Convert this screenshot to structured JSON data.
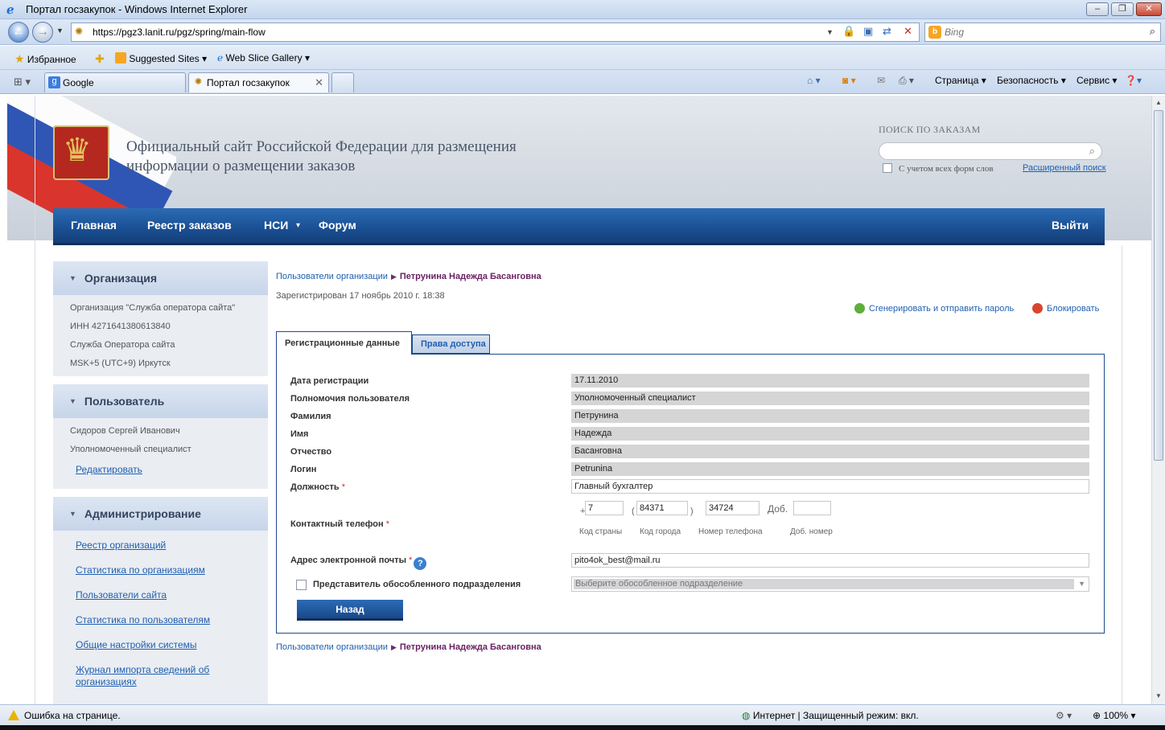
{
  "browser": {
    "window_title": "Портал госзакупок - Windows Internet Explorer",
    "url": "https://pgz3.lanit.ru/pgz/spring/main-flow",
    "search_placeholder": "Bing",
    "favorites_label": "Избранное",
    "suggested_sites": "Suggested Sites",
    "web_slice_gallery": "Web Slice Gallery",
    "tabs": [
      {
        "label": "Google"
      },
      {
        "label": "Портал госзакупок"
      }
    ],
    "commands": {
      "page": "Страница",
      "safety": "Безопасность",
      "tools": "Сервис"
    },
    "status_left": "Ошибка на странице.",
    "status_zone": "Интернет | Защищенный режим: вкл.",
    "zoom": "100%"
  },
  "header": {
    "title": "Официальный сайт Российской Федерации для размещения информации о размещении заказов",
    "search_title": "ПОИСК ПО ЗАКАЗАМ",
    "all_forms_label": "С учетом всех форм слов",
    "advanced_search": "Расширенный поиск"
  },
  "nav": {
    "items": [
      "Главная",
      "Реестр заказов",
      "НСИ",
      "Форум"
    ],
    "nsi_arrow": "▾",
    "logout": "Выйти"
  },
  "sidebar": {
    "organization": {
      "title": "Организация",
      "lines": [
        "Организация \"Служба оператора сайта\"",
        "ИНН 4271641380613840",
        "Служба Оператора сайта",
        "MSK+5 (UTC+9) Иркутск"
      ]
    },
    "user": {
      "title": "Пользователь",
      "lines": [
        "Сидоров Сергей Иванович",
        "Уполномоченный специалист"
      ],
      "edit_link": "Редактировать"
    },
    "admin": {
      "title": "Администрирование",
      "links": [
        "Реестр организаций",
        "Статистика по организациям",
        "Пользователи сайта",
        "Статистика по пользователям",
        "Общие настройки системы",
        "Журнал импорта сведений об организациях"
      ]
    }
  },
  "content": {
    "breadcrumb_parent": "Пользователи организации",
    "breadcrumb_current": "Петрунина Надежда Басанговна",
    "registered": "Зарегистрирован 17 ноябрь 2010 г. 18:38",
    "generate_password": "Сгенерировать и отправить пароль",
    "block": "Блокировать",
    "tabs": {
      "registration": "Регистрационные данные",
      "access": "Права доступа"
    },
    "fields": [
      {
        "label": "Дата регистрации",
        "value": "17.11.2010"
      },
      {
        "label": "Полномочия пользователя",
        "value": "Уполномоченный специалист"
      },
      {
        "label": "Фамилия",
        "value": "Петрунина"
      },
      {
        "label": "Имя",
        "value": "Надежда"
      },
      {
        "label": "Отчество",
        "value": "Басанговна"
      },
      {
        "label": "Логин",
        "value": "Petrunina"
      }
    ],
    "position": {
      "label": "Должность",
      "value": "Главный бухгалтер"
    },
    "phone": {
      "label": "Контактный телефон",
      "plus": "+",
      "country": "7",
      "city": "84371",
      "number": "34724",
      "ext_label": "Доб.",
      "ext": "",
      "cap_country": "Код страны",
      "cap_city": "Код города",
      "cap_number": "Номер телефона",
      "cap_ext": "Доб. номер"
    },
    "email": {
      "label": "Адрес электронной почты",
      "value": "pito4ok_best@mail.ru"
    },
    "branch": {
      "label": "Представитель обособленного подразделения",
      "placeholder": "Выберите обособленное подразделение"
    },
    "back_button": "Назад",
    "required_mark": "*"
  }
}
